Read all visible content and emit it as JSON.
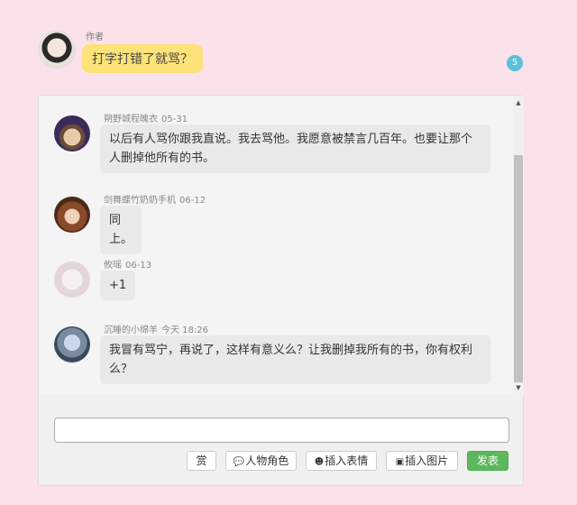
{
  "author_post": {
    "role": "作者",
    "message": "打字打错了就骂？",
    "count": "5"
  },
  "comments": [
    {
      "name": "朔野城程魄衣",
      "time": "05-31",
      "text": "以后有人骂你跟我直说。我去骂他。我愿意被禁言几百年。也要让那个人删掉他所有的书。"
    },
    {
      "name": "剑舞蝶竹奶奶手机",
      "time": "06-12",
      "text": "同上。"
    },
    {
      "name": "攸瑶",
      "time": "06-13",
      "text": "+1"
    },
    {
      "name": "沉睡的小绵羊",
      "time": "今天 18:26",
      "text": "我冒有骂宁，再说了，这样有意义么？让我删掉我所有的书，你有权利么？"
    }
  ],
  "composer": {
    "value": ""
  },
  "toolbar": {
    "reward": "赏",
    "character": "人物角色",
    "emoji": "插入表情",
    "image": "插入图片",
    "send": "发表"
  },
  "icons": {
    "character": "comments-icon",
    "emoji": "face-icon",
    "image": "image-icon"
  },
  "colors": {
    "background": "#fbe2ea",
    "author_bubble": "#fde27a",
    "badge": "#5bc0de",
    "send_button": "#5cb85c"
  }
}
